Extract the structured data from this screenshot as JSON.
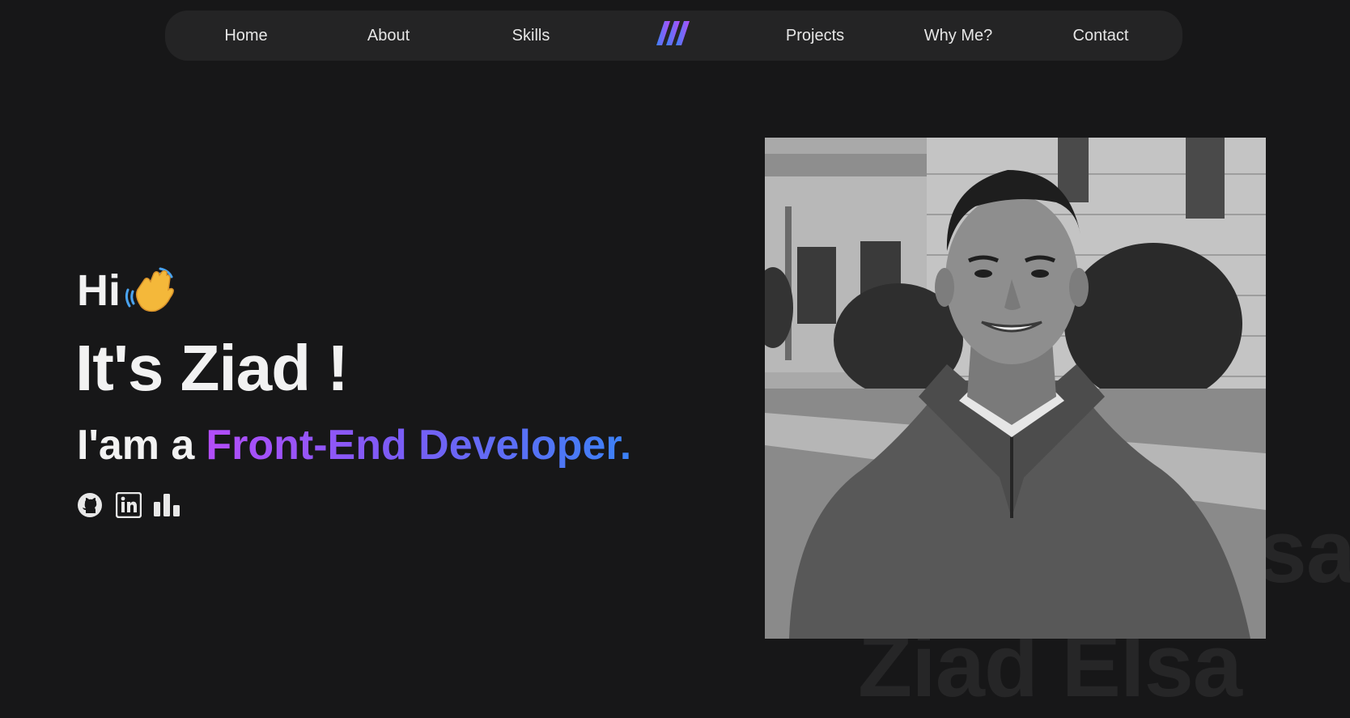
{
  "nav": {
    "links": [
      {
        "label": "Home"
      },
      {
        "label": "About"
      },
      {
        "label": "Skills"
      },
      {
        "label": "Projects"
      },
      {
        "label": "Why Me?"
      },
      {
        "label": "Contact"
      }
    ],
    "logo_icon": "triple-slash-logo-icon"
  },
  "hero": {
    "greeting": "Hi",
    "greeting_icon": "waving-hand-icon",
    "name_line": "It's Ziad !",
    "role_prefix": "I'am a",
    "role_highlight": "Front-End Developer.",
    "social_icons": [
      "github-icon",
      "linkedin-icon",
      "stats-icon"
    ]
  },
  "watermark": {
    "line1": "sa",
    "line2": "Ziad Elsa"
  },
  "colors": {
    "background": "#171718",
    "nav_background": "#242425",
    "gradient_start": "#b44dfb",
    "gradient_end": "#3b82f6"
  }
}
